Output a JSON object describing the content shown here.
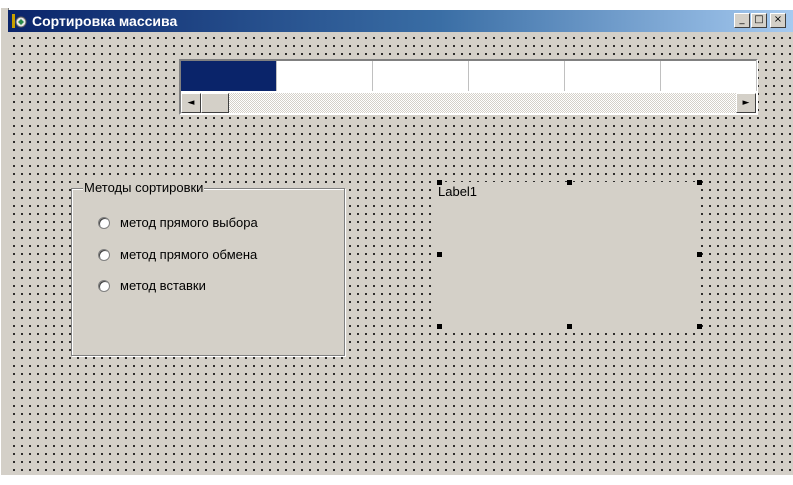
{
  "window": {
    "title": "Сортировка массива",
    "icon": "delphi-form-icon",
    "buttons": {
      "minimize": "_",
      "maximize": "□",
      "close": "×"
    }
  },
  "grid": {
    "columns": 6,
    "selected_column": 1,
    "scroll_left": "◄",
    "scroll_right": "►"
  },
  "group": {
    "caption": "Методы сортировки",
    "options": [
      {
        "label": "метод прямого выбора"
      },
      {
        "label": "метод прямого обмена"
      },
      {
        "label": "метод вставки"
      }
    ]
  },
  "label1": {
    "text": "Label1"
  },
  "colors": {
    "title_start": "#0a246a",
    "title_end": "#a6caf0",
    "face": "#d4d0c8",
    "selection": "#0a246a"
  }
}
